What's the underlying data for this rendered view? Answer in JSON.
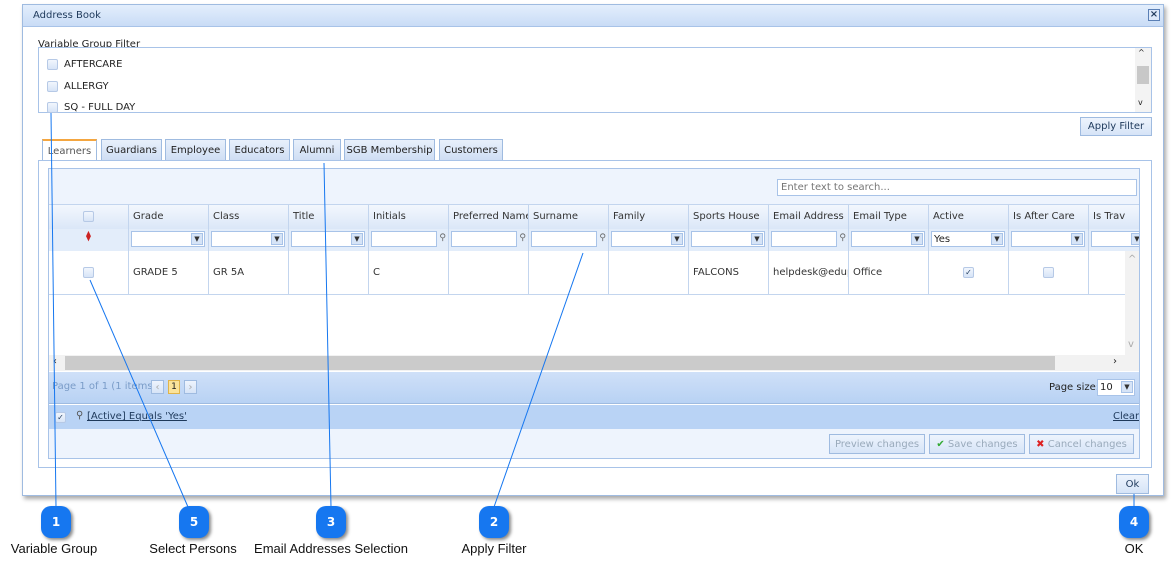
{
  "window": {
    "title": "Address Book",
    "close_icon": "close-icon"
  },
  "variable_group": {
    "label": "Variable Group Filter",
    "items": [
      "AFTERCARE",
      "ALLERGY",
      "SQ - FULL DAY"
    ],
    "apply_label": "Apply Filter"
  },
  "tabs": [
    "Learners",
    "Guardians",
    "Employee",
    "Educators",
    "Alumni",
    "SGB Membership",
    "Customers"
  ],
  "grid": {
    "search_placeholder": "Enter text to search...",
    "columns": [
      "Grade",
      "Class",
      "Title",
      "Initials",
      "Preferred Name",
      "Surname",
      "Family",
      "Sports House",
      "Email Address",
      "Email Type",
      "Active",
      "Is After Care",
      "Is Trav"
    ],
    "filter_active_value": "Yes",
    "row": {
      "Grade": "GRADE 5",
      "Class": "GR 5A",
      "Title": "",
      "Initials": "C",
      "Preferred Name": "",
      "Surname": "",
      "Family": "",
      "Sports House": "FALCONS",
      "Email Address": "helpdesk@edupa",
      "Email Type": "Office",
      "Active": true,
      "Is After Care": false
    },
    "pager": {
      "info": "Page 1 of 1 (1 items)",
      "current_page": "1",
      "page_size_label": "Page size:",
      "page_size": "10"
    },
    "filter_expression": "[Active] Equals 'Yes'",
    "clear_label": "Clear",
    "preview_label": "Preview changes",
    "save_label": "Save changes",
    "cancel_label": "Cancel changes"
  },
  "ok_label": "Ok",
  "callouts": [
    {
      "num": "1",
      "label": "Variable Group"
    },
    {
      "num": "5",
      "label": "Select Persons"
    },
    {
      "num": "3",
      "label": "Email Addresses Selection"
    },
    {
      "num": "2",
      "label": "Apply Filter"
    },
    {
      "num": "4",
      "label": "OK"
    }
  ],
  "colors": {
    "accent": "#1677f0",
    "tab_active": "#f4a640",
    "border": "#a8c3e8"
  }
}
